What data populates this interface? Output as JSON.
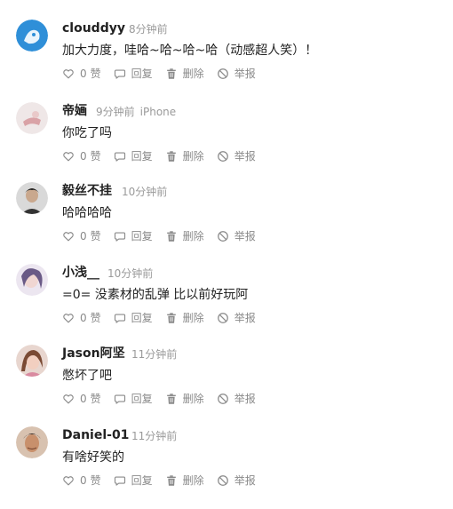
{
  "comments": [
    {
      "username": "clouddyy",
      "time": "8分钟前",
      "device": "",
      "text": "加大力度，哇哈~哈~哈~哈（动感超人笑）！",
      "likes": "0",
      "like_unit": "赞",
      "reply": "回复",
      "delete": "删除",
      "report": "举报"
    },
    {
      "username": "帝婳",
      "time": "9分钟前",
      "device": "iPhone",
      "text": "你吃了吗",
      "likes": "0",
      "like_unit": "赞",
      "reply": "回复",
      "delete": "删除",
      "report": "举报"
    },
    {
      "username": "毅丝不挂",
      "time": "10分钟前",
      "device": "",
      "text": "哈哈哈哈",
      "likes": "0",
      "like_unit": "赞",
      "reply": "回复",
      "delete": "删除",
      "report": "举报"
    },
    {
      "username": "小浅__",
      "time": "10分钟前",
      "device": "",
      "text": "=0= 没素材的乱弹 比以前好玩阿",
      "likes": "0",
      "like_unit": "赞",
      "reply": "回复",
      "delete": "删除",
      "report": "举报"
    },
    {
      "username": "Jason阿坚",
      "time": "11分钟前",
      "device": "",
      "text": "憋坏了吧",
      "likes": "0",
      "like_unit": "赞",
      "reply": "回复",
      "delete": "删除",
      "report": "举报"
    },
    {
      "username": "Daniel-01",
      "time": "11分钟前",
      "device": "",
      "text": "有啥好笑的",
      "likes": "0",
      "like_unit": "赞",
      "reply": "回复",
      "delete": "删除",
      "report": "举报"
    }
  ],
  "icons": {
    "like": "heart-icon",
    "reply": "comment-bubble-icon",
    "delete": "trash-icon",
    "report": "prohibited-icon"
  },
  "colors": {
    "text": "#222222",
    "meta": "#9a9a9a",
    "action": "#8a8a8a"
  }
}
